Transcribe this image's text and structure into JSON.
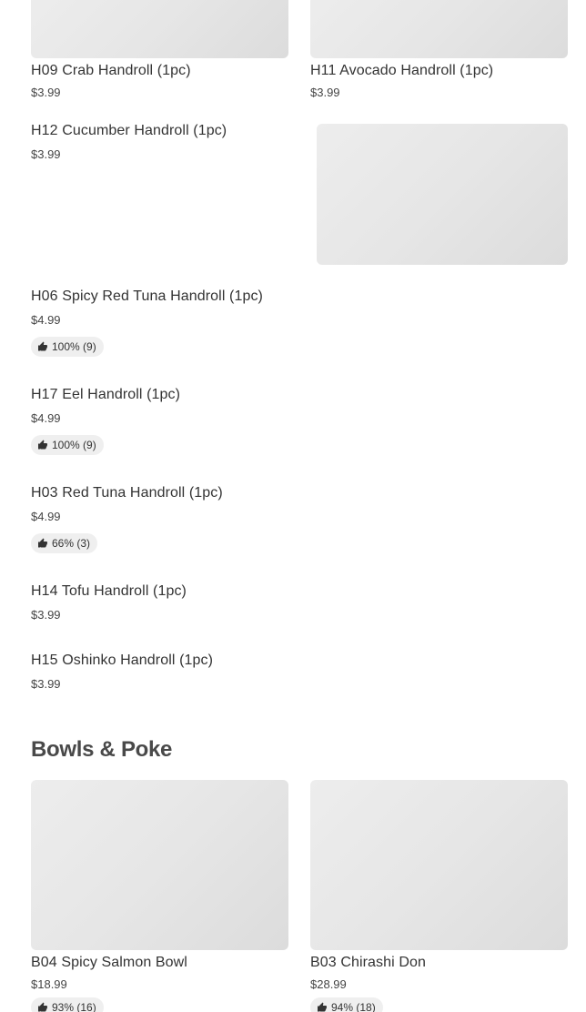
{
  "items": {
    "h09": {
      "name": "H09 Crab Handroll (1pc)",
      "price": "$3.99"
    },
    "h11": {
      "name": "H11 Avocado Handroll (1pc)",
      "price": "$3.99"
    },
    "h12": {
      "name": "H12 Cucumber Handroll (1pc)",
      "price": "$3.99"
    },
    "h06": {
      "name": "H06 Spicy Red Tuna Handroll (1pc)",
      "price": "$4.99",
      "rating": "100% (9)"
    },
    "h17": {
      "name": "H17 Eel Handroll (1pc)",
      "price": "$4.99",
      "rating": "100% (9)"
    },
    "h03": {
      "name": "H03 Red Tuna Handroll (1pc)",
      "price": "$4.99",
      "rating": "66% (3)"
    },
    "h14": {
      "name": "H14 Tofu Handroll (1pc)",
      "price": "$3.99"
    },
    "h15": {
      "name": "H15 Oshinko Handroll (1pc)",
      "price": "$3.99"
    }
  },
  "bowls_section": {
    "title": "Bowls & Poke",
    "items": {
      "b04": {
        "name": "B04 Spicy Salmon Bowl",
        "price": "$18.99",
        "rating": "93% (16)"
      },
      "b03": {
        "name": "B03 Chirashi Don",
        "price": "$28.99",
        "rating": "94% (18)"
      }
    }
  },
  "icons": {
    "rating": "thumbs-up-icon"
  },
  "colors": {
    "image_placeholder": "#e6e6e6",
    "rating_pill": "#efefef",
    "text": "#333333"
  }
}
